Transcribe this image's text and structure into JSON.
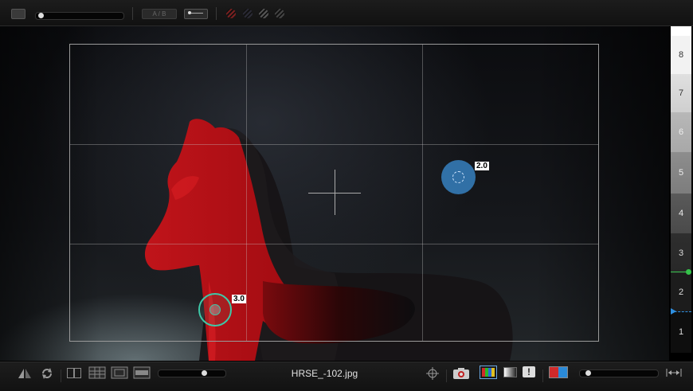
{
  "toolbar": {
    "ab_label": "A / B",
    "hatch_colors": [
      "#7a2020",
      "#2a2a35",
      "#555",
      "#444"
    ]
  },
  "viewer": {
    "markers": [
      {
        "label": "3.0",
        "color": "#3ec8a8"
      },
      {
        "label": "2.0",
        "color": "#3b8fd6"
      }
    ]
  },
  "zones": {
    "labels": [
      "8",
      "7",
      "6",
      "5",
      "4",
      "3",
      "2",
      "1"
    ],
    "indicator_colors": {
      "green": "#35c24a",
      "blue": "#2f8fe0"
    }
  },
  "bottombar": {
    "filename": "HRSE_-102.jpg"
  }
}
